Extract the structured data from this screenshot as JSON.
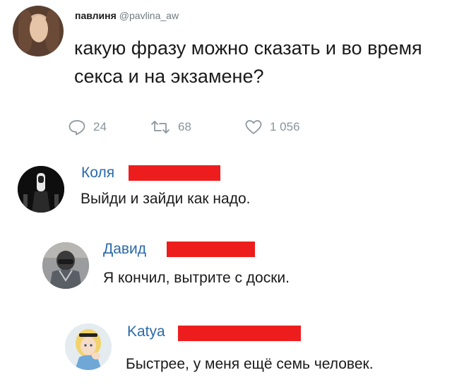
{
  "tweet": {
    "author_name": "павлиня",
    "handle": "@pavlina_aw",
    "text": "какую фразу можно сказать и во время секса и на экзамене?",
    "actions": {
      "reply_icon": "reply-icon",
      "reply_count": "24",
      "retweet_icon": "retweet-icon",
      "retweet_count": "68",
      "like_icon": "heart-icon",
      "like_count": "1 056"
    }
  },
  "comments": [
    {
      "author": "Коля",
      "text": "Выйди и зайди как надо.",
      "redaction_color": "#ee1d1d"
    },
    {
      "author": "Давид",
      "text": "Я кончил, вытрите с доски.",
      "redaction_color": "#ee1d1d"
    },
    {
      "author": "Katya",
      "text": "Быстрее, у меня ещё семь человек.",
      "redaction_color": "#ee1d1d"
    }
  ],
  "colors": {
    "name_link": "#2a6aa8",
    "meta_gray": "#8a949b",
    "text": "#1a1a1a"
  }
}
